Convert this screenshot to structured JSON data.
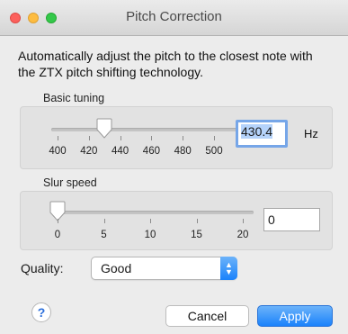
{
  "window": {
    "title": "Pitch Correction"
  },
  "description": "Automatically adjust the pitch to the closest note with the ZTX pitch shifting technology.",
  "basic_tuning": {
    "label": "Basic tuning",
    "value": "430.4",
    "unit": "Hz",
    "min": 400,
    "max": 500,
    "slider_value": 430,
    "ticks": [
      "400",
      "420",
      "440",
      "460",
      "480",
      "500"
    ]
  },
  "slur_speed": {
    "label": "Slur speed",
    "value": "0",
    "min": 0,
    "max": 20,
    "slider_value": 0,
    "ticks": [
      "0",
      "5",
      "10",
      "15",
      "20"
    ]
  },
  "quality": {
    "label": "Quality:",
    "selected": "Good"
  },
  "buttons": {
    "help": "?",
    "cancel": "Cancel",
    "apply": "Apply"
  },
  "colors": {
    "accent": "#1a82fb",
    "focus_ring": "#76a6e8",
    "close": "#fc605c",
    "minimize": "#fdbc40",
    "maximize": "#34c84a"
  }
}
